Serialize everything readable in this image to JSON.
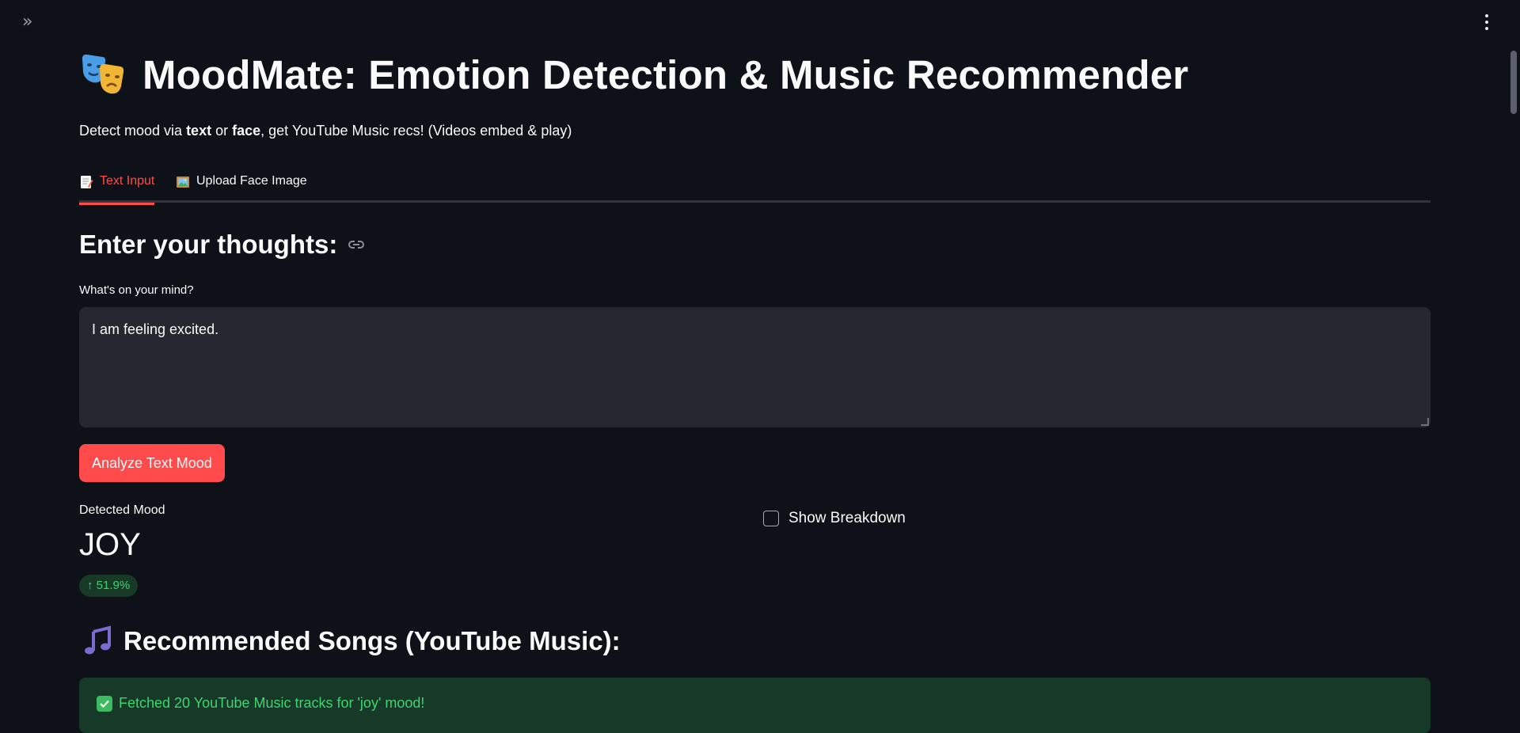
{
  "header": {
    "sidebar_toggle": "»",
    "title": "MoodMate: Emotion Detection & Music Recommender",
    "subtitle_before": "Detect mood via ",
    "subtitle_text_word": "text",
    "subtitle_or": " or ",
    "subtitle_face_word": "face",
    "subtitle_after": ", get YouTube Music recs! (Videos embed & play)"
  },
  "tabs": [
    {
      "label": "Text Input",
      "icon": "memo-icon",
      "active": true
    },
    {
      "label": "Upload Face Image",
      "icon": "framed-picture-icon",
      "active": false
    }
  ],
  "text_section": {
    "heading": "Enter your thoughts:",
    "field_label": "What's on your mind?",
    "field_value": "I am feeling excited.",
    "analyze_button": "Analyze Text Mood"
  },
  "metric": {
    "label": "Detected Mood",
    "value": "JOY",
    "delta": "51.9%",
    "delta_arrow": "↑"
  },
  "breakdown": {
    "label": "Show Breakdown",
    "checked": false
  },
  "recommendations": {
    "heading": "Recommended Songs (YouTube Music):",
    "success_message": "Fetched 20 YouTube Music tracks for 'joy' mood!"
  },
  "colors": {
    "background": "#0e1117",
    "accent": "#ff4b4b",
    "input_bg": "#262730",
    "success_bg": "#173928",
    "success_text": "#3dd56d"
  }
}
